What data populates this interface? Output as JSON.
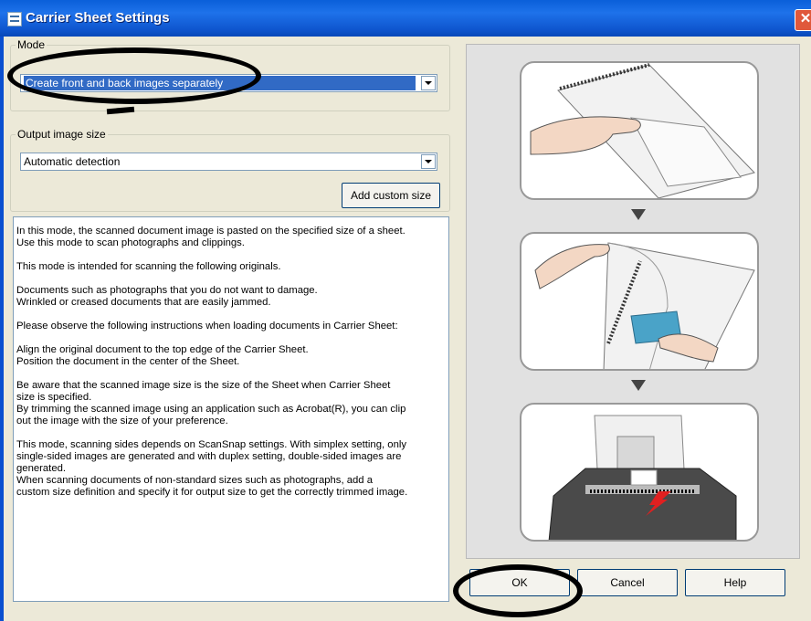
{
  "window": {
    "title": "Carrier Sheet Settings",
    "close_symbol": "✕"
  },
  "mode_group": {
    "legend": "Mode",
    "selected_value": "Create front and back images separately"
  },
  "output_group": {
    "legend": "Output image size",
    "selected_value": "Automatic detection",
    "add_custom_size_label": "Add custom size"
  },
  "description": [
    "In this mode, the scanned document image is pasted on the specified size of a sheet.\nUse this mode to scan photographs and clippings.",
    "This mode is intended for scanning the following originals.",
    "Documents such as photographs that you do not want to damage.\n Wrinkled or creased documents that are easily jammed.",
    "Please observe the following instructions when loading documents in Carrier Sheet:",
    "Align the original document to the top edge of the Carrier Sheet.\nPosition the document in the center of the Sheet.",
    "Be aware that the scanned image size is the size of the Sheet when Carrier Sheet\nsize is specified.\nBy trimming the scanned image using an application such as Acrobat(R), you can clip\nout the image with the size of your preference.",
    "This mode, scanning sides depends on ScanSnap settings. With simplex setting, only\nsingle-sided images are generated and with duplex setting, double-sided images are\ngenerated.\nWhen scanning documents of non-standard sizes such as photographs, add a\ncustom size definition and specify it for output size to get the correctly trimmed image."
  ],
  "buttons": {
    "ok": "OK",
    "cancel": "Cancel",
    "help": "Help"
  },
  "colors": {
    "titlebar": "#0a5fd9",
    "selection": "#316ac5",
    "annotation": "#000000"
  },
  "icons": [
    "app-icon",
    "close-icon",
    "dropdown-arrow-icon",
    "step-arrow-icon"
  ]
}
